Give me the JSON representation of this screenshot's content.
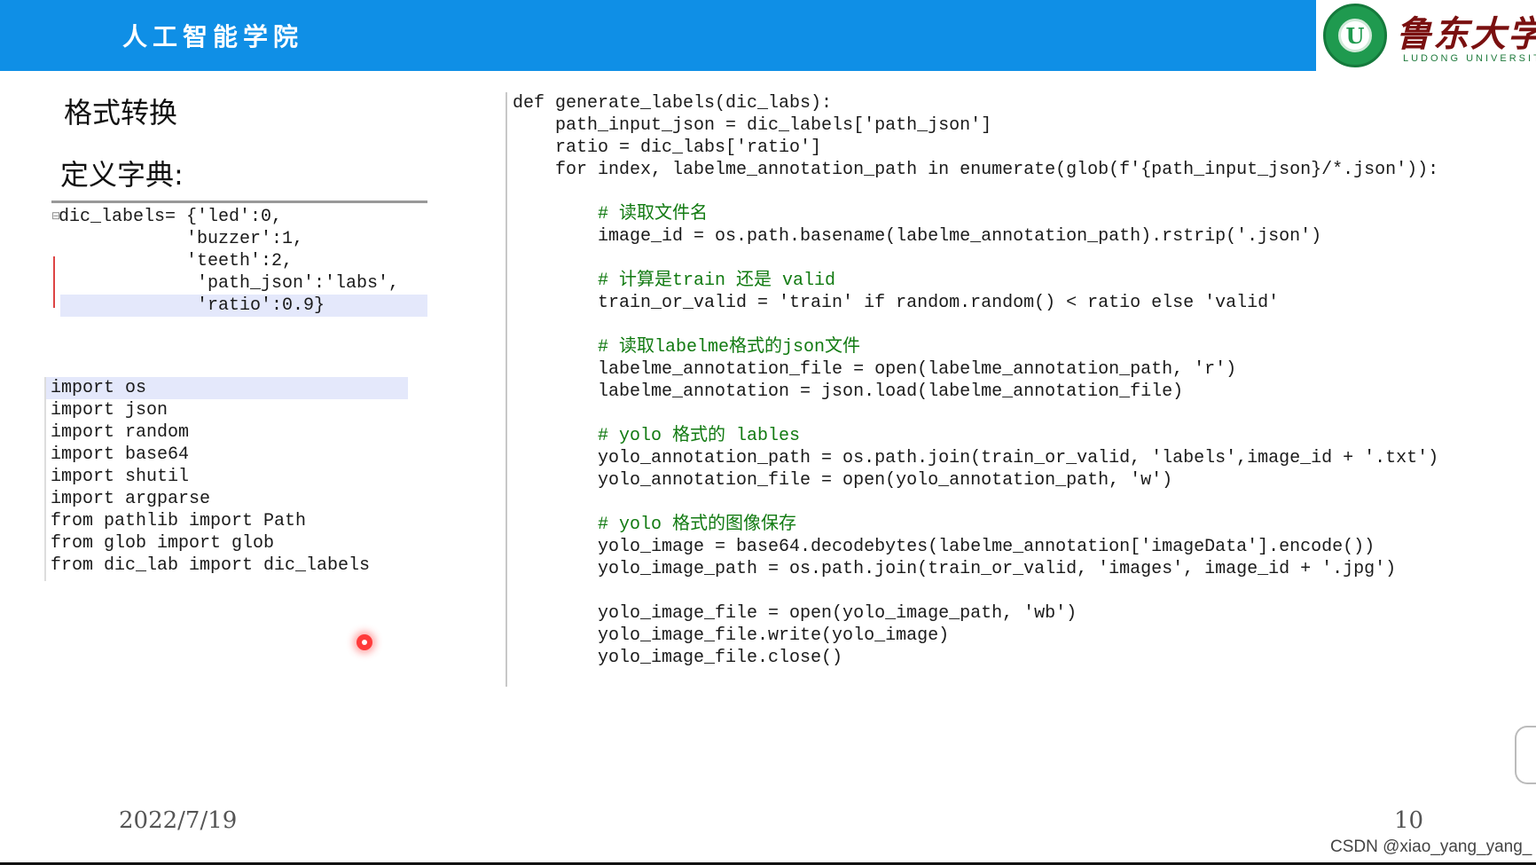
{
  "header": {
    "title": "人工智能学院",
    "university_cn": "鲁东大学",
    "university_en": "LUDONG UNIVERSITY",
    "colors": {
      "bar": "#0f8fe6",
      "seal": "#1f9a4f",
      "university_cn": "#7a1010"
    }
  },
  "slide": {
    "title": "格式转换",
    "subtitle": "定义字典:"
  },
  "dict_code": {
    "lines": [
      "dic_labels= {'led':0,",
      "            'buzzer':1,",
      "            'teeth':2,",
      "             'path_json':'labs',",
      "             'ratio':0.9}"
    ]
  },
  "imports_code": {
    "lines": [
      "import os",
      "import json",
      "import random",
      "import base64",
      "import shutil",
      "import argparse",
      "from pathlib import Path",
      "from glob import glob",
      "from dic_lab import dic_labels"
    ]
  },
  "main_code": {
    "lines": [
      "def generate_labels(dic_labs):",
      "    path_input_json = dic_labels['path_json']",
      "    ratio = dic_labs['ratio']",
      "    for index, labelme_annotation_path in enumerate(glob(f'{path_input_json}/*.json')):",
      "",
      "        # 读取文件名",
      "        image_id = os.path.basename(labelme_annotation_path).rstrip('.json')",
      "",
      "        # 计算是train 还是 valid",
      "        train_or_valid = 'train' if random.random() < ratio else 'valid'",
      "",
      "        # 读取labelme格式的json文件",
      "        labelme_annotation_file = open(labelme_annotation_path, 'r')",
      "        labelme_annotation = json.load(labelme_annotation_file)",
      "",
      "        # yolo 格式的 lables",
      "        yolo_annotation_path = os.path.join(train_or_valid, 'labels',image_id + '.txt')",
      "        yolo_annotation_file = open(yolo_annotation_path, 'w')",
      "",
      "        # yolo 格式的图像保存",
      "        yolo_image = base64.decodebytes(labelme_annotation['imageData'].encode())",
      "        yolo_image_path = os.path.join(train_or_valid, 'images', image_id + '.jpg')",
      "",
      "        yolo_image_file = open(yolo_image_path, 'wb')",
      "        yolo_image_file.write(yolo_image)",
      "        yolo_image_file.close()"
    ]
  },
  "footer": {
    "date": "2022/7/19",
    "page_number": "10",
    "watermark": "CSDN @xiao_yang_yang_"
  }
}
